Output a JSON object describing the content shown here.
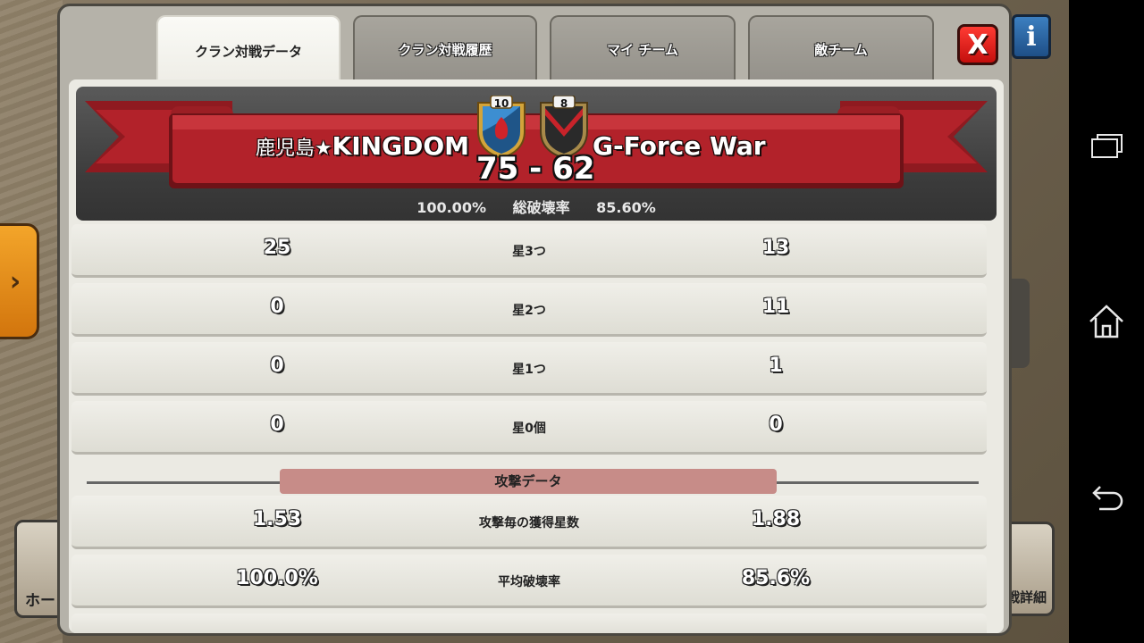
{
  "tabs": [
    {
      "label": "クラン対戦データ",
      "active": true
    },
    {
      "label": "クラン対戦履歴",
      "active": false
    },
    {
      "label": "マイ チーム",
      "active": false
    },
    {
      "label": "敵チーム",
      "active": false
    }
  ],
  "close_label": "X",
  "info_label": "i",
  "war": {
    "clan_left_prefix": "鹿児島★",
    "clan_left_name": "KINGDOM",
    "clan_right_name": "G-Force War",
    "score_left": "75",
    "score_sep": "-",
    "score_right": "62",
    "badge_left_level": "10",
    "badge_right_level": "8",
    "destruction_left": "100.00%",
    "destruction_label": "総破壊率",
    "destruction_right": "85.60%"
  },
  "star_rows": [
    {
      "left": "25",
      "label": "星3つ",
      "right": "13"
    },
    {
      "left": "0",
      "label": "星2つ",
      "right": "11"
    },
    {
      "left": "0",
      "label": "星1つ",
      "right": "1"
    },
    {
      "left": "0",
      "label": "星0個",
      "right": "0"
    }
  ],
  "attack_section_title": "攻撃データ",
  "attack_rows": [
    {
      "left": "1.53",
      "label": "攻撃毎の獲得星数",
      "right": "1.88"
    },
    {
      "left": "100.0%",
      "label": "平均破壊率",
      "right": "85.6%"
    }
  ],
  "background": {
    "home_button_label": "ホー",
    "detail_button_label": "戦詳細"
  },
  "colors": {
    "ribbon_red": "#b2222a",
    "close_red": "#e0201b",
    "section_header": "#c78c88",
    "badge_left_blue": "#3d8ed1",
    "badge_right_dark": "#2a2a2a"
  }
}
